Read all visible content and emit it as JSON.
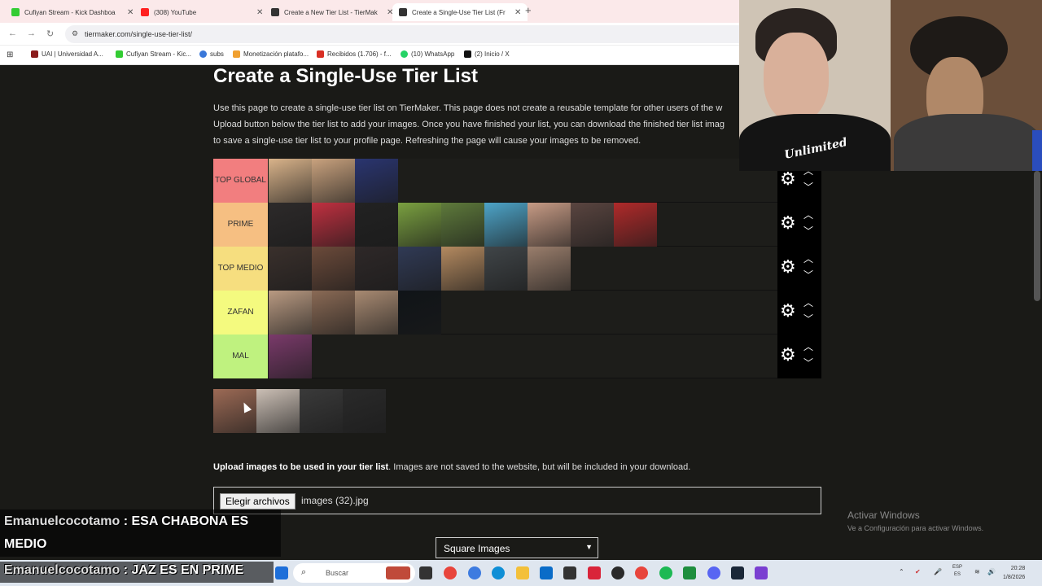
{
  "browser": {
    "tabs": [
      {
        "title": "Cufiyan Stream - Kick Dashboa",
        "fav": "#33cc33",
        "active": false
      },
      {
        "title": "(308) YouTube",
        "fav": "#ff2020",
        "active": false
      },
      {
        "title": "Create a New Tier List - TierMak",
        "fav": "#333333",
        "active": false
      },
      {
        "title": "Create a Single-Use Tier List (Fr",
        "fav": "#333333",
        "active": true
      }
    ],
    "new_tab": "+",
    "url": "tiermaker.com/single-use-tier-list/",
    "bookmarks": [
      {
        "label": "UAI | Universidad A...",
        "fav": "#8a1c1c"
      },
      {
        "label": "Cufiyan Stream - Kic...",
        "fav": "#33cc33"
      },
      {
        "label": "subs",
        "fav": "#3a78d9"
      },
      {
        "label": "Monetización platafo...",
        "fav": "#f0a030"
      },
      {
        "label": "Recibidos (1.706) - f...",
        "fav": "#d93025"
      },
      {
        "label": "(10) WhatsApp",
        "fav": "#25d366"
      },
      {
        "label": "(2) Inicio / X",
        "fav": "#111111"
      }
    ]
  },
  "page": {
    "title": "Create a Single-Use Tier List",
    "intro_lines": [
      "Use this page to create a single-use tier list on TierMaker. This page does not create a reusable template for other users of the w",
      "Upload button below the tier list to add your images. Once you have finished your list, you can download the finished tier list imag",
      "to save a single-use tier list to your profile page. Refreshing the page will cause your images to be removed."
    ],
    "tiers": [
      {
        "label": "TOP GLOBAL",
        "color": "#f27e7f",
        "items": [
          "#d9b38a",
          "#c9a27e",
          "#2a3570"
        ]
      },
      {
        "label": "PRIME",
        "color": "#f6bf82",
        "items": [
          "#2d2a2a",
          "#c03040",
          "#222222",
          "#7aa040",
          "#5e7a3b",
          "#4da4c8",
          "#c79b85",
          "#5a4540",
          "#b02a2a"
        ]
      },
      {
        "label": "TOP MEDIO",
        "color": "#f6de7f",
        "items": [
          "#3a302c",
          "#6b4a3a",
          "#2e2828",
          "#303a55",
          "#b48a60",
          "#404548",
          "#9a7e6c"
        ]
      },
      {
        "label": "ZAFAN",
        "color": "#f4fa7f",
        "items": [
          "#b99a82",
          "#8a6a55",
          "#a88a72",
          "#101418"
        ]
      },
      {
        "label": "MAL",
        "color": "#bff27f",
        "items": [
          "#7a3a6a"
        ]
      }
    ],
    "pool_items": [
      "#9c6a55",
      "#cbbfb5",
      "#3a3a3a",
      "#2a2a2a"
    ],
    "upload_bold": "Upload images to be used in your tier list",
    "upload_rest": ". Images are not saved to the website, but will be included in your download.",
    "file_button": "Elegir archivos",
    "file_name": "images (32).jpg",
    "image_mode": "Square Images",
    "activate_title": "Activar Windows",
    "activate_sub": "Ve a Configuración para activar Windows."
  },
  "webcam": {
    "overlay_text": "Unlimited"
  },
  "chat": [
    {
      "user": "Emanuelcocotamo",
      "line1": " : ESA CHABONA ES",
      "line2": "MEDIO"
    },
    {
      "user": "Emanuelcocotamo",
      "message": " : JAZ ES EN PRIME"
    }
  ],
  "taskbar": {
    "search_placeholder": "Buscar",
    "lang": "ESP",
    "lang_sub": "ES",
    "time": "20:28",
    "date": "1/8/2026"
  }
}
